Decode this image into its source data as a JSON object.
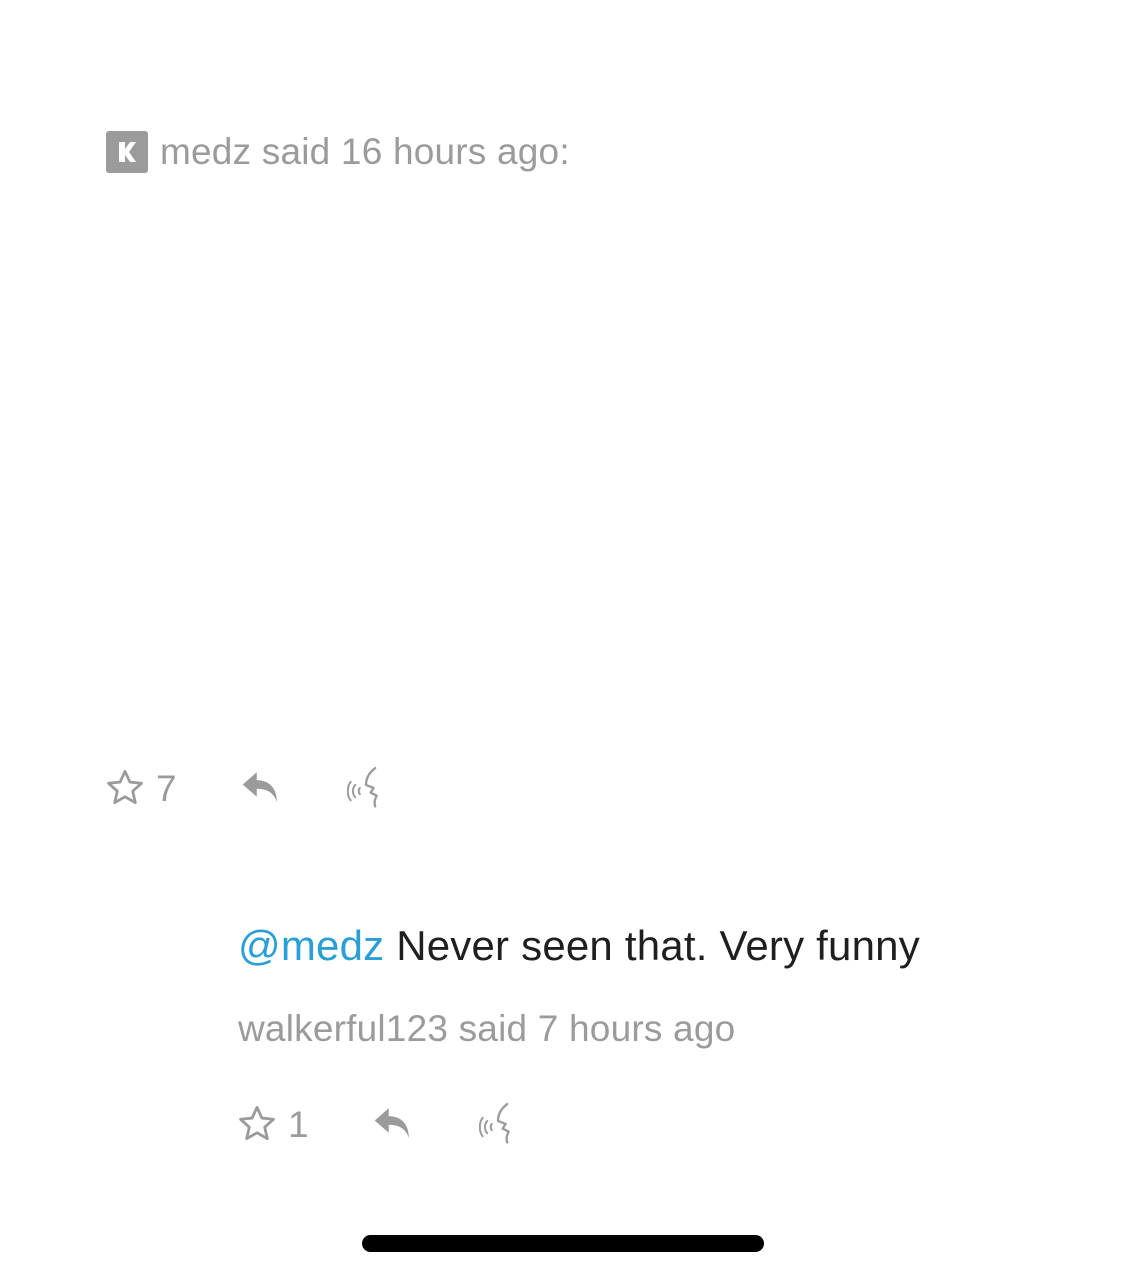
{
  "main_comment": {
    "author": "medz",
    "meta": "medz said 16 hours ago:",
    "star_count": "7"
  },
  "reply_comment": {
    "mention": "@medz",
    "text": " Never seen that. Very funny",
    "meta": "walkerful123 said 7 hours ago",
    "star_count": "1"
  },
  "icons": {
    "badge": "kickstarter-k-icon",
    "star": "star-outline-icon",
    "reply": "reply-arrow-icon",
    "report": "report-flag-icon"
  },
  "colors": {
    "meta_gray": "#9b9b9b",
    "mention_blue": "#2a9fd6",
    "body_text": "#1f1f1f"
  }
}
